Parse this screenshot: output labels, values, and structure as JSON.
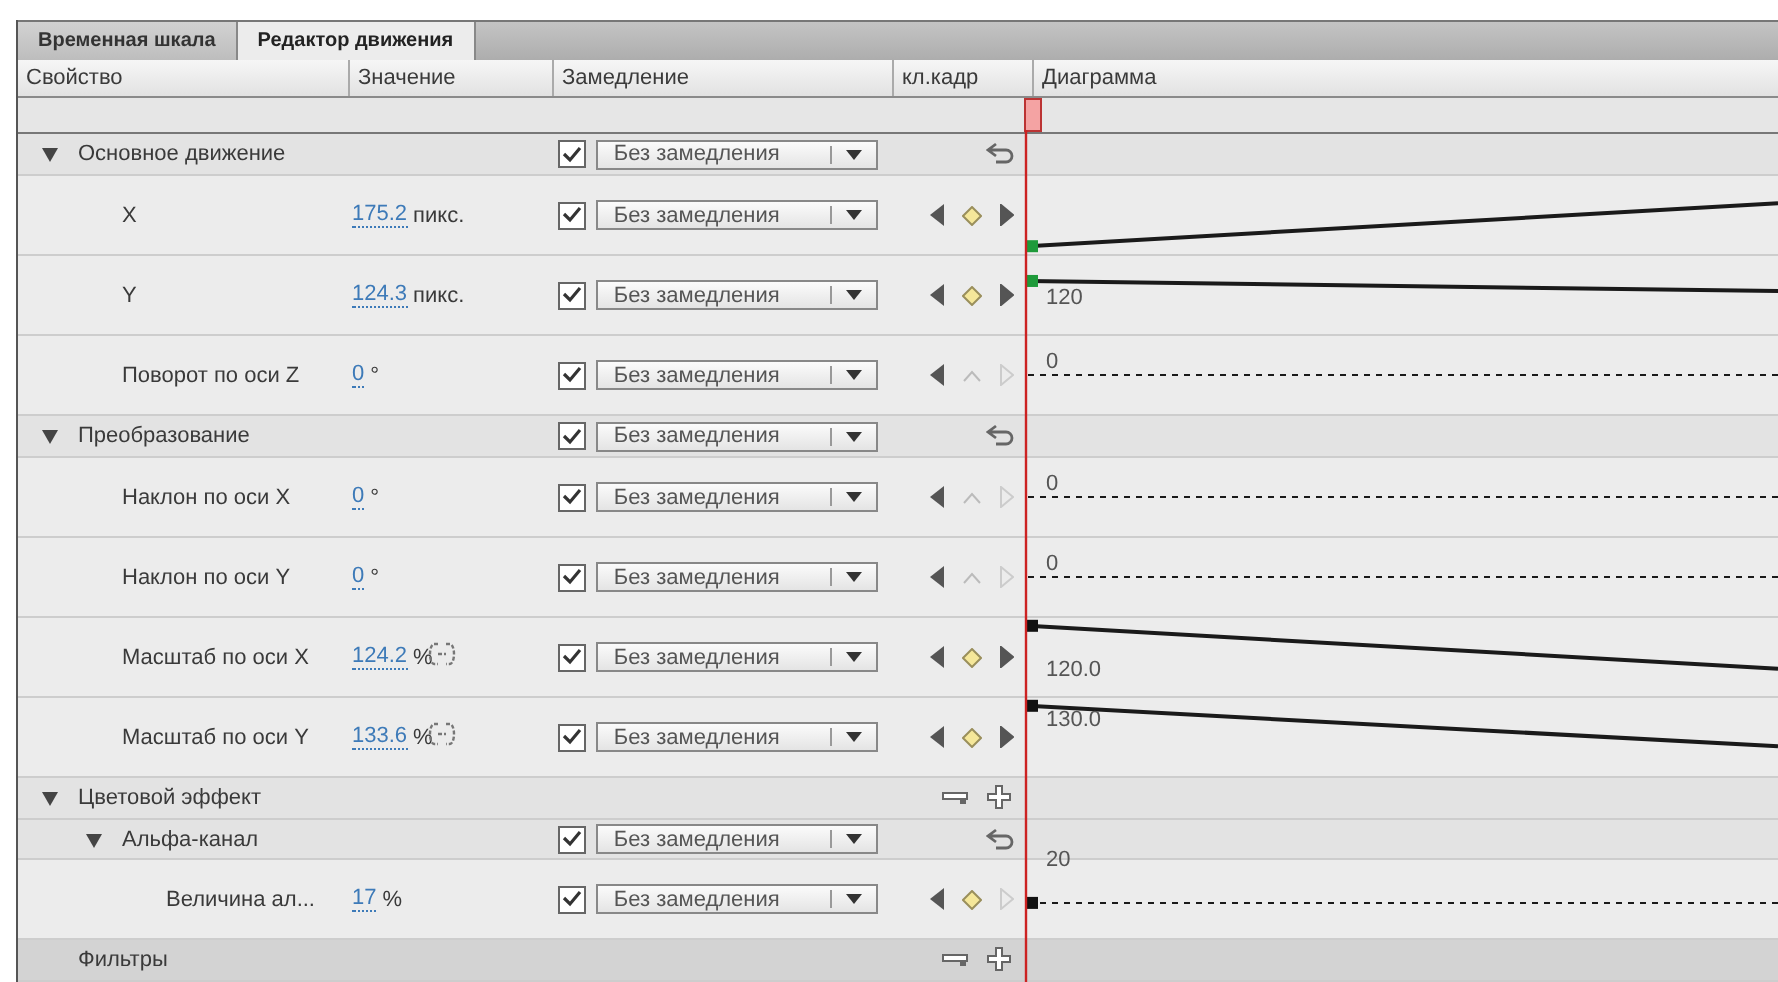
{
  "tabs": [
    {
      "label": "Временная шкала",
      "selected": false
    },
    {
      "label": "Редактор движения",
      "selected": true
    }
  ],
  "columns": [
    "Свойство",
    "Значение",
    "Замедление",
    "кл.кадр",
    "Диаграмма"
  ],
  "rows": [
    {
      "kind": "group",
      "label": "Основное движение",
      "expanded": true,
      "ease": {
        "checked": true,
        "label": "Без замедления"
      },
      "actions": [
        {
          "kind": "reset"
        }
      ],
      "children": [
        {
          "kind": "property",
          "label": "X",
          "value": "175.2",
          "unit": "пикс.",
          "ease": {
            "checked": true,
            "label": "Без замедления"
          },
          "keyframe": {
            "prev": true,
            "on": true,
            "next": true
          },
          "graph": {
            "kind": "rise",
            "marker": {
              "selected": true
            }
          }
        },
        {
          "kind": "property",
          "label": "Y",
          "value": "124.3",
          "unit": "пикс.",
          "ease": {
            "checked": true,
            "label": "Без замедления"
          },
          "keyframe": {
            "prev": true,
            "on": true,
            "next": true
          },
          "graph": {
            "kind": "dip",
            "label": "120",
            "marker": {
              "selected": true
            }
          }
        },
        {
          "kind": "property",
          "label": "Поворот по оси Z",
          "value": "0",
          "unit": "°",
          "ease": {
            "checked": true,
            "label": "Без замедления"
          },
          "keyframe": {
            "prev": true,
            "on": false,
            "next": false
          },
          "graph": {
            "kind": "flat",
            "label": "0"
          }
        }
      ]
    },
    {
      "kind": "group",
      "label": "Преобразование",
      "expanded": true,
      "ease": {
        "checked": true,
        "label": "Без замедления"
      },
      "actions": [
        {
          "kind": "reset"
        }
      ],
      "children": [
        {
          "kind": "property",
          "label": "Наклон по оси X",
          "value": "0",
          "unit": "°",
          "ease": {
            "checked": true,
            "label": "Без замедления"
          },
          "keyframe": {
            "prev": true,
            "on": false,
            "next": false
          },
          "graph": {
            "kind": "flat",
            "label": "0"
          }
        },
        {
          "kind": "property",
          "label": "Наклон по оси Y",
          "value": "0",
          "unit": "°",
          "ease": {
            "checked": true,
            "label": "Без замедления"
          },
          "keyframe": {
            "prev": true,
            "on": false,
            "next": false
          },
          "graph": {
            "kind": "flat",
            "label": "0"
          }
        },
        {
          "kind": "property",
          "label": "Масштаб по оси X",
          "value": "124.2",
          "unit": "%",
          "linked": true,
          "ease": {
            "checked": true,
            "label": "Без замедления"
          },
          "keyframe": {
            "prev": true,
            "on": true,
            "next": true
          },
          "graph": {
            "kind": "fall",
            "label": "120.0",
            "marker": {
              "selected": false
            }
          }
        },
        {
          "kind": "property",
          "label": "Масштаб по оси Y",
          "value": "133.6",
          "unit": "%",
          "linked": true,
          "ease": {
            "checked": true,
            "label": "Без замедления"
          },
          "keyframe": {
            "prev": true,
            "on": true,
            "next": true
          },
          "graph": {
            "kind": "fall_top",
            "label": "130.0",
            "marker": {
              "selected": false
            }
          }
        }
      ]
    },
    {
      "kind": "group",
      "label": "Цветовой эффект",
      "expanded": true,
      "actions": [
        {
          "kind": "remove"
        },
        {
          "kind": "add"
        }
      ],
      "children": [
        {
          "kind": "group",
          "label": "Альфа-канал",
          "expanded": true,
          "ease": {
            "checked": true,
            "label": "Без замедления"
          },
          "actions": [
            {
              "kind": "reset"
            }
          ],
          "children": [
            {
              "kind": "property",
              "label": "Величина ал...",
              "value": "17",
              "unit": "%",
              "ease": {
                "checked": true,
                "label": "Без замедления"
              },
              "keyframe": {
                "prev": true,
                "on": true,
                "next": false
              },
              "graph": {
                "kind": "flat_low",
                "label": "20",
                "marker": {
                  "selected": false
                }
              }
            }
          ]
        }
      ]
    },
    {
      "kind": "group",
      "label": "Фильтры",
      "dark": true,
      "actions": [
        {
          "kind": "remove"
        },
        {
          "kind": "add"
        }
      ]
    }
  ]
}
